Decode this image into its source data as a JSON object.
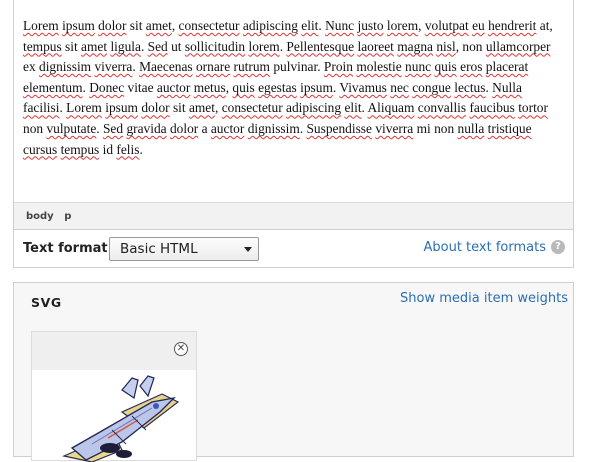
{
  "editor": {
    "body_segments": [
      {
        "t": "Lorem",
        "s": 1
      },
      {
        "t": " "
      },
      {
        "t": "ipsum",
        "s": 1
      },
      {
        "t": " "
      },
      {
        "t": "dolor",
        "s": 1
      },
      {
        "t": " sit "
      },
      {
        "t": "amet",
        "s": 1
      },
      {
        "t": ", "
      },
      {
        "t": "consectetur",
        "s": 1
      },
      {
        "t": " "
      },
      {
        "t": "adipiscing",
        "s": 1
      },
      {
        "t": " "
      },
      {
        "t": "elit",
        "s": 1
      },
      {
        "t": ". "
      },
      {
        "t": "Nunc",
        "s": 1
      },
      {
        "t": " "
      },
      {
        "t": "justo",
        "s": 1
      },
      {
        "t": " "
      },
      {
        "t": "lorem",
        "s": 1
      },
      {
        "t": ", "
      },
      {
        "t": "volutpat",
        "s": 1
      },
      {
        "t": " "
      },
      {
        "t": "eu",
        "s": 1
      },
      {
        "t": " "
      },
      {
        "t": "hendrerit",
        "s": 1
      },
      {
        "t": " at, "
      },
      {
        "t": "tempus",
        "s": 1
      },
      {
        "t": " sit "
      },
      {
        "t": "amet",
        "s": 1
      },
      {
        "t": " "
      },
      {
        "t": "ligula",
        "s": 1
      },
      {
        "t": ". "
      },
      {
        "t": "Sed",
        "s": 1
      },
      {
        "t": " ut "
      },
      {
        "t": "sollicitudin",
        "s": 1
      },
      {
        "t": " "
      },
      {
        "t": "lorem",
        "s": 1
      },
      {
        "t": ". "
      },
      {
        "t": "Pellentesque",
        "s": 1
      },
      {
        "t": " "
      },
      {
        "t": "laoreet",
        "s": 1
      },
      {
        "t": " "
      },
      {
        "t": "magna",
        "s": 1
      },
      {
        "t": " "
      },
      {
        "t": "nisl",
        "s": 1
      },
      {
        "t": ", non "
      },
      {
        "t": "ullamcorper",
        "s": 1
      },
      {
        "t": " ex "
      },
      {
        "t": "dignissim",
        "s": 1
      },
      {
        "t": " "
      },
      {
        "t": "viverra",
        "s": 1
      },
      {
        "t": ". "
      },
      {
        "t": "Maecenas",
        "s": 1
      },
      {
        "t": " "
      },
      {
        "t": "ornare",
        "s": 1
      },
      {
        "t": " "
      },
      {
        "t": "rutrum",
        "s": 1
      },
      {
        "t": " pulvinar. "
      },
      {
        "t": "Proin",
        "s": 1
      },
      {
        "t": " "
      },
      {
        "t": "molestie",
        "s": 1
      },
      {
        "t": " "
      },
      {
        "t": "nunc",
        "s": 1
      },
      {
        "t": " "
      },
      {
        "t": "quis",
        "s": 1
      },
      {
        "t": " "
      },
      {
        "t": "eros",
        "s": 1
      },
      {
        "t": " "
      },
      {
        "t": "placerat",
        "s": 1
      },
      {
        "t": " "
      },
      {
        "t": "elementum",
        "s": 1
      },
      {
        "t": ". "
      },
      {
        "t": "Donec",
        "s": 1
      },
      {
        "t": " vitae "
      },
      {
        "t": "auctor",
        "s": 1
      },
      {
        "t": " "
      },
      {
        "t": "metus",
        "s": 1
      },
      {
        "t": ", "
      },
      {
        "t": "quis",
        "s": 1
      },
      {
        "t": " "
      },
      {
        "t": "egestas",
        "s": 1
      },
      {
        "t": " "
      },
      {
        "t": "ipsum",
        "s": 1
      },
      {
        "t": ". "
      },
      {
        "t": "Vivamus",
        "s": 1
      },
      {
        "t": " "
      },
      {
        "t": "nec",
        "s": 1
      },
      {
        "t": " "
      },
      {
        "t": "congue",
        "s": 1
      },
      {
        "t": " "
      },
      {
        "t": "lectus",
        "s": 1
      },
      {
        "t": ". "
      },
      {
        "t": "Nulla",
        "s": 1
      },
      {
        "t": " "
      },
      {
        "t": "facilisi",
        "s": 1
      },
      {
        "t": ". "
      },
      {
        "t": "Lorem",
        "s": 1
      },
      {
        "t": " "
      },
      {
        "t": "ipsum",
        "s": 1
      },
      {
        "t": " "
      },
      {
        "t": "dolor",
        "s": 1
      },
      {
        "t": " sit "
      },
      {
        "t": "amet",
        "s": 1
      },
      {
        "t": ", "
      },
      {
        "t": "consectetur",
        "s": 1
      },
      {
        "t": " "
      },
      {
        "t": "adipiscing",
        "s": 1
      },
      {
        "t": " "
      },
      {
        "t": "elit",
        "s": 1
      },
      {
        "t": ". "
      },
      {
        "t": "Aliquam",
        "s": 1
      },
      {
        "t": " "
      },
      {
        "t": "convallis",
        "s": 1
      },
      {
        "t": " "
      },
      {
        "t": "faucibus",
        "s": 1
      },
      {
        "t": " "
      },
      {
        "t": "tortor",
        "s": 1
      },
      {
        "t": " non "
      },
      {
        "t": "vulputate",
        "s": 1
      },
      {
        "t": ". "
      },
      {
        "t": "Sed",
        "s": 1
      },
      {
        "t": " "
      },
      {
        "t": "gravida",
        "s": 1
      },
      {
        "t": " "
      },
      {
        "t": "dolor",
        "s": 1
      },
      {
        "t": " a "
      },
      {
        "t": "auctor",
        "s": 1
      },
      {
        "t": " "
      },
      {
        "t": "dignissim",
        "s": 1
      },
      {
        "t": ". "
      },
      {
        "t": "Suspendisse",
        "s": 1
      },
      {
        "t": " "
      },
      {
        "t": "viverra",
        "s": 1
      },
      {
        "t": " mi non "
      },
      {
        "t": "nulla",
        "s": 1
      },
      {
        "t": " "
      },
      {
        "t": "tristique",
        "s": 1
      },
      {
        "t": " "
      },
      {
        "t": "cursus",
        "s": 1
      },
      {
        "t": " "
      },
      {
        "t": "tempus",
        "s": 1
      },
      {
        "t": " id "
      },
      {
        "t": "felis",
        "s": 1
      },
      {
        "t": "."
      }
    ],
    "path": [
      "body",
      "p"
    ]
  },
  "text_format": {
    "label": "Text format",
    "selected": "Basic HTML",
    "about_link": "About text formats",
    "help_icon": "question-icon"
  },
  "media": {
    "title": "SVG",
    "weights_link": "Show media item weights",
    "remove_icon": "close-circle-icon",
    "thumbnail": "fighter-jet-illustration"
  },
  "colors": {
    "link": "#2a6fb3",
    "spellcheck_underline": "#dd3333"
  }
}
